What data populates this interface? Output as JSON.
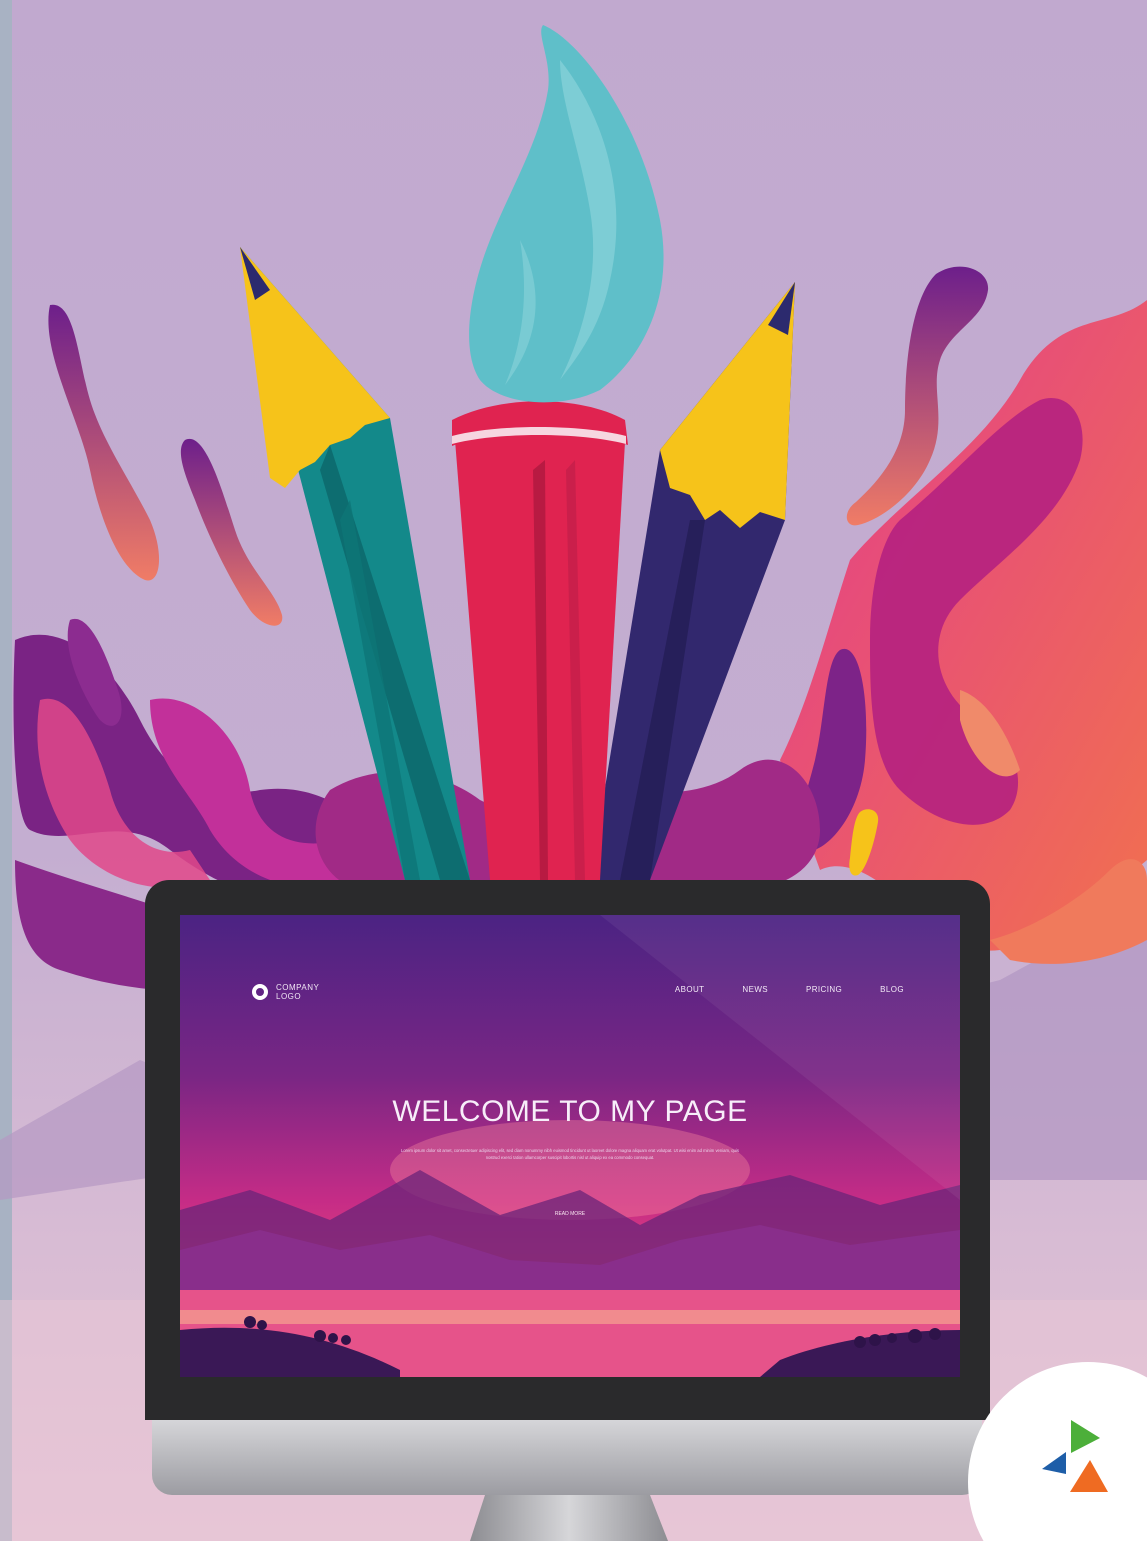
{
  "website": {
    "logo": {
      "line1": "COMPANY",
      "line2": "LOGO"
    },
    "nav": [
      "ABOUT",
      "NEWS",
      "PRICING",
      "BLOG"
    ],
    "hero_title": "WELCOME TO MY PAGE",
    "hero_body": "Lorem ipsum dolor sit amet, consectetuer adipiscing elit, sed diam nonummy nibh euismod tincidunt ut laoreet dolore magna aliquam erat volutpat. Ut wisi enim ad minim veniam, quis nostrud exerci tation ullamcorper suscipit lobortis nisl ut aliquip ex ea commodo consequat.",
    "cta": "READ MORE"
  },
  "colors": {
    "background": "#c0aed0",
    "pencil_teal": "#13898a",
    "brush_red": "#e02350",
    "pencil_navy": "#32286e",
    "brush_tip": "#5fbfc9",
    "wood_yellow": "#f6c31a",
    "splash_magenta": "#a3217b",
    "splash_pink": "#ea3f8b",
    "monitor_bezel": "#2a2a2c",
    "monitor_silver": "#c9c9cc"
  },
  "icons": [
    "company-logo-ring-icon",
    "triangle-logo-icon"
  ]
}
